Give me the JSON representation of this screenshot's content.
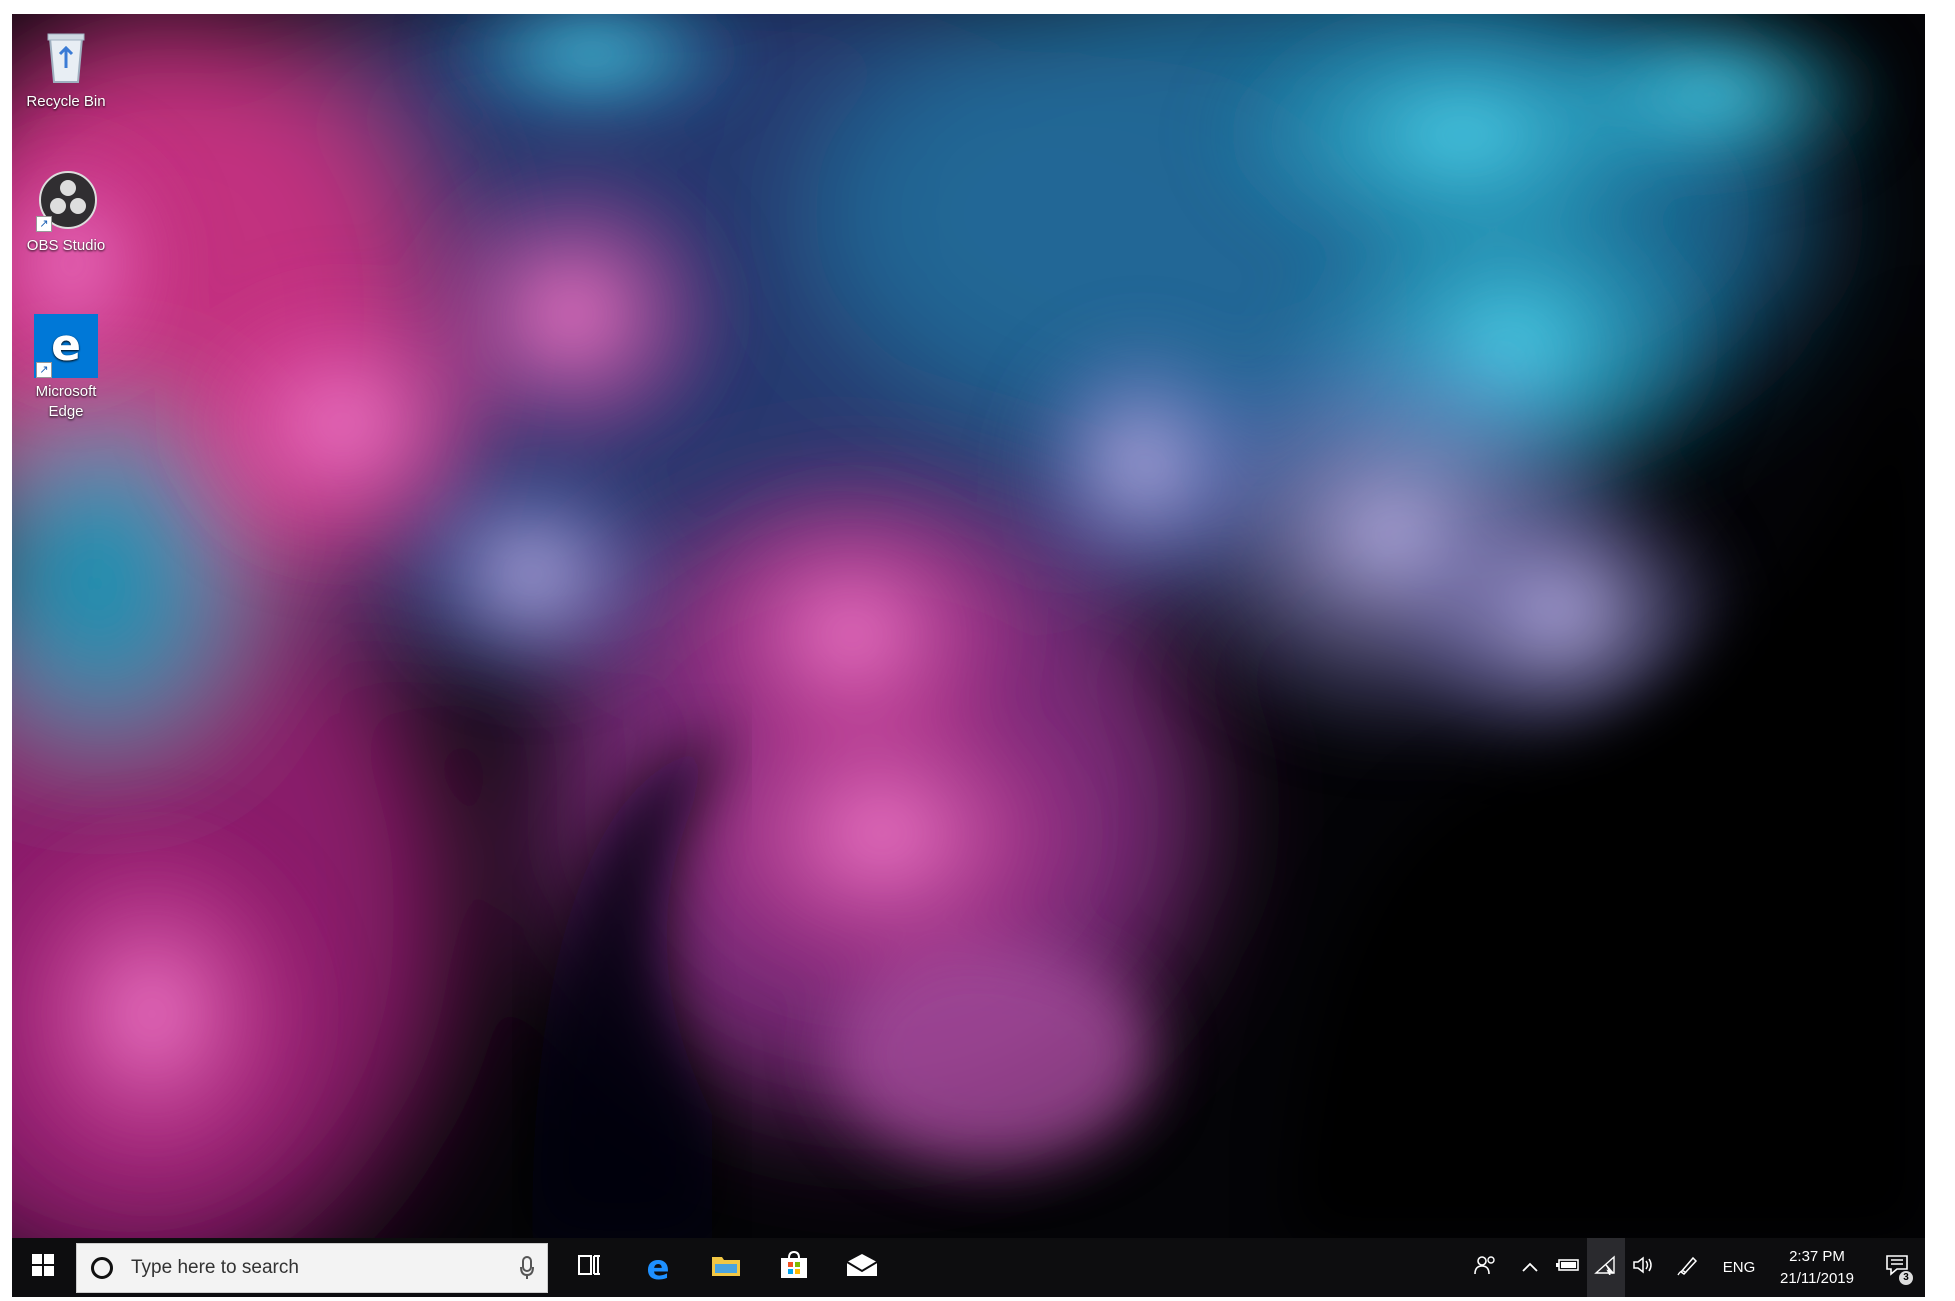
{
  "desktop": {
    "icons": [
      {
        "label": "Recycle Bin",
        "icon": "recycle-bin-icon"
      },
      {
        "label": "OBS Studio",
        "icon": "obs-icon"
      },
      {
        "label": "Microsoft Edge",
        "icon": "edge-icon"
      }
    ]
  },
  "taskbar": {
    "start_icon": "windows-logo-icon",
    "search": {
      "placeholder": "Type here to search"
    },
    "apps": [
      {
        "name": "task-view",
        "icon": "task-view-icon"
      },
      {
        "name": "edge",
        "icon": "edge-icon"
      },
      {
        "name": "file-explorer",
        "icon": "folder-icon"
      },
      {
        "name": "store",
        "icon": "store-icon"
      },
      {
        "name": "mail",
        "icon": "mail-icon"
      }
    ],
    "tray": {
      "language": "ENG",
      "time": "2:37 PM",
      "date": "21/11/2019",
      "notification_count": "3"
    }
  },
  "colors": {
    "taskbar": "#0d0d0f",
    "accent": "#0078d7"
  }
}
